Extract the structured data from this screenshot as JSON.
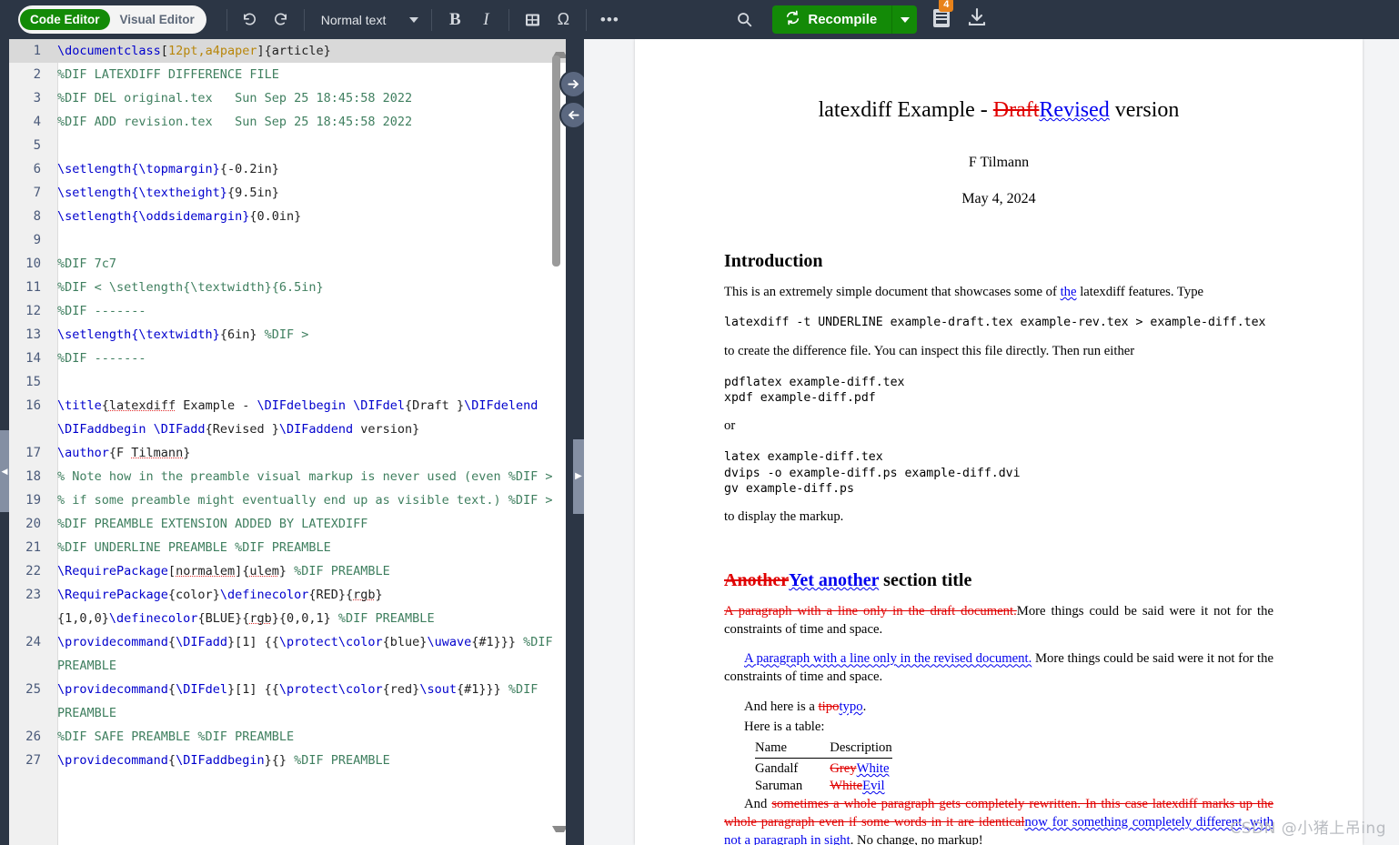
{
  "toolbar": {
    "code_editor_label": "Code Editor",
    "visual_editor_label": "Visual Editor",
    "undo_icon": "undo-icon",
    "redo_icon": "redo-icon",
    "style_select_value": "Normal text",
    "bold_label": "B",
    "italic_label": "I",
    "table_icon": "table-icon",
    "symbol_label": "Ω",
    "more_label": "•••",
    "search_icon": "search-icon",
    "recompile_label": "Recompile",
    "recompile_icon": "refresh-icon",
    "logs_icon": "logs-icon",
    "logs_badge": "4",
    "download_icon": "download-icon"
  },
  "splitter": {
    "sync_to_pdf_icon": "arrow-right-icon",
    "sync_to_code_icon": "arrow-left-icon",
    "handle_icon": "chevron-right-icon",
    "rail_handle_icon": "chevron-left-icon"
  },
  "editor": {
    "lines": [
      {
        "n": "1",
        "active": true,
        "tokens": [
          {
            "t": "\\documentclass",
            "c": "k-cmd"
          },
          {
            "t": "[",
            "c": "k-plain"
          },
          {
            "t": "12pt,a4paper",
            "c": "k-opt"
          },
          {
            "t": "]{article}",
            "c": "k-plain"
          }
        ]
      },
      {
        "n": "2",
        "tokens": [
          {
            "t": "%DIF LATEXDIFF DIFFERENCE FILE",
            "c": "k-com"
          }
        ]
      },
      {
        "n": "3",
        "tokens": [
          {
            "t": "%DIF DEL original.tex   Sun Sep 25 18:45:58 2022",
            "c": "k-com"
          }
        ]
      },
      {
        "n": "4",
        "tokens": [
          {
            "t": "%DIF ADD revision.tex   Sun Sep 25 18:45:58 2022",
            "c": "k-com"
          }
        ]
      },
      {
        "n": "5",
        "tokens": [
          {
            "t": "",
            "c": "k-plain"
          }
        ]
      },
      {
        "n": "6",
        "tokens": [
          {
            "t": "\\setlength{\\topmargin}",
            "c": "k-cmd"
          },
          {
            "t": "{-0.2in}",
            "c": "k-plain"
          }
        ]
      },
      {
        "n": "7",
        "tokens": [
          {
            "t": "\\setlength{\\textheight}",
            "c": "k-cmd"
          },
          {
            "t": "{9.5in}",
            "c": "k-plain"
          }
        ]
      },
      {
        "n": "8",
        "tokens": [
          {
            "t": "\\setlength{\\oddsidemargin}",
            "c": "k-cmd"
          },
          {
            "t": "{0.0in}",
            "c": "k-plain"
          }
        ]
      },
      {
        "n": "9",
        "tokens": [
          {
            "t": "",
            "c": "k-plain"
          }
        ]
      },
      {
        "n": "10",
        "tokens": [
          {
            "t": "%DIF 7c7",
            "c": "k-com"
          }
        ]
      },
      {
        "n": "11",
        "tokens": [
          {
            "t": "%DIF < \\setlength{\\textwidth}{6.5in}",
            "c": "k-com"
          }
        ]
      },
      {
        "n": "12",
        "tokens": [
          {
            "t": "%DIF -------",
            "c": "k-com"
          }
        ]
      },
      {
        "n": "13",
        "tokens": [
          {
            "t": "\\setlength{\\textwidth}",
            "c": "k-cmd"
          },
          {
            "t": "{6in} ",
            "c": "k-plain"
          },
          {
            "t": "%DIF >",
            "c": "k-com"
          }
        ]
      },
      {
        "n": "14",
        "tokens": [
          {
            "t": "%DIF -------",
            "c": "k-com"
          }
        ]
      },
      {
        "n": "15",
        "tokens": [
          {
            "t": "",
            "c": "k-plain"
          }
        ]
      },
      {
        "n": "16",
        "tokens": [
          {
            "t": "\\title",
            "c": "k-cmd"
          },
          {
            "t": "{",
            "c": "k-plain"
          },
          {
            "t": "latexdiff",
            "c": "k-plain sp"
          },
          {
            "t": " Example - ",
            "c": "k-plain"
          },
          {
            "t": "\\DIFdelbegin \\DIFdel",
            "c": "k-cmd"
          },
          {
            "t": "{Draft }",
            "c": "k-plain"
          },
          {
            "t": "\\DIFdelend \\DIFaddbegin \\DIFadd",
            "c": "k-cmd"
          },
          {
            "t": "{Revised }",
            "c": "k-plain"
          },
          {
            "t": "\\DIFaddend",
            "c": "k-cmd"
          },
          {
            "t": " version}",
            "c": "k-plain"
          }
        ]
      },
      {
        "n": "17",
        "tokens": [
          {
            "t": "\\author",
            "c": "k-cmd"
          },
          {
            "t": "{F ",
            "c": "k-plain"
          },
          {
            "t": "Tilmann",
            "c": "k-plain sp"
          },
          {
            "t": "}",
            "c": "k-plain"
          }
        ]
      },
      {
        "n": "18",
        "tokens": [
          {
            "t": "% Note how in the preamble visual markup is never used (even %DIF >",
            "c": "k-com"
          }
        ]
      },
      {
        "n": "19",
        "tokens": [
          {
            "t": "% if some preamble might eventually end up as visible text.) %DIF >",
            "c": "k-com"
          }
        ]
      },
      {
        "n": "20",
        "tokens": [
          {
            "t": "%DIF PREAMBLE EXTENSION ADDED BY LATEXDIFF",
            "c": "k-com"
          }
        ]
      },
      {
        "n": "21",
        "tokens": [
          {
            "t": "%DIF UNDERLINE PREAMBLE %DIF PREAMBLE",
            "c": "k-com"
          }
        ]
      },
      {
        "n": "22",
        "tokens": [
          {
            "t": "\\RequirePackage",
            "c": "k-cmd"
          },
          {
            "t": "[",
            "c": "k-plain"
          },
          {
            "t": "normalem",
            "c": "k-plain sp"
          },
          {
            "t": "]{",
            "c": "k-plain"
          },
          {
            "t": "ulem",
            "c": "k-plain sp"
          },
          {
            "t": "} ",
            "c": "k-plain"
          },
          {
            "t": "%DIF PREAMBLE",
            "c": "k-com"
          }
        ]
      },
      {
        "n": "23",
        "tokens": [
          {
            "t": "\\RequirePackage",
            "c": "k-cmd"
          },
          {
            "t": "{color}",
            "c": "k-plain"
          },
          {
            "t": "\\definecolor",
            "c": "k-cmd"
          },
          {
            "t": "{RED}{",
            "c": "k-plain"
          },
          {
            "t": "rgb",
            "c": "k-plain sp"
          },
          {
            "t": "}{1,0,0}",
            "c": "k-plain"
          },
          {
            "t": "\\definecolor",
            "c": "k-cmd"
          },
          {
            "t": "{BLUE}{",
            "c": "k-plain"
          },
          {
            "t": "rgb",
            "c": "k-plain sp"
          },
          {
            "t": "}{0,0,1} ",
            "c": "k-plain"
          },
          {
            "t": "%DIF PREAMBLE",
            "c": "k-com"
          }
        ]
      },
      {
        "n": "24",
        "tokens": [
          {
            "t": "\\providecommand",
            "c": "k-cmd"
          },
          {
            "t": "{",
            "c": "k-plain"
          },
          {
            "t": "\\DIFadd",
            "c": "k-cmd"
          },
          {
            "t": "}[1] {{",
            "c": "k-plain"
          },
          {
            "t": "\\protect\\color",
            "c": "k-cmd"
          },
          {
            "t": "{blue}",
            "c": "k-plain"
          },
          {
            "t": "\\uwave",
            "c": "k-cmd"
          },
          {
            "t": "{#1}}} ",
            "c": "k-plain"
          },
          {
            "t": "%DIF PREAMBLE",
            "c": "k-com"
          }
        ]
      },
      {
        "n": "25",
        "tokens": [
          {
            "t": "\\providecommand",
            "c": "k-cmd"
          },
          {
            "t": "{",
            "c": "k-plain"
          },
          {
            "t": "\\DIFdel",
            "c": "k-cmd"
          },
          {
            "t": "}[1] {{",
            "c": "k-plain"
          },
          {
            "t": "\\protect\\color",
            "c": "k-cmd"
          },
          {
            "t": "{red}",
            "c": "k-plain"
          },
          {
            "t": "\\sout",
            "c": "k-cmd"
          },
          {
            "t": "{#1}}} ",
            "c": "k-plain"
          },
          {
            "t": "%DIF PREAMBLE",
            "c": "k-com"
          }
        ]
      },
      {
        "n": "26",
        "tokens": [
          {
            "t": "%DIF SAFE PREAMBLE %DIF PREAMBLE",
            "c": "k-com"
          }
        ]
      },
      {
        "n": "27",
        "tokens": [
          {
            "t": "\\providecommand",
            "c": "k-cmd"
          },
          {
            "t": "{",
            "c": "k-plain"
          },
          {
            "t": "\\DIFaddbegin",
            "c": "k-cmd"
          },
          {
            "t": "}{} ",
            "c": "k-plain"
          },
          {
            "t": "%DIF PREAMBLE",
            "c": "k-com"
          }
        ]
      }
    ]
  },
  "pdf": {
    "title_prefix": "latexdiff Example - ",
    "title_del": "Draft",
    "title_add": "Revised",
    "title_suffix": " version",
    "author": "F Tilmann",
    "date": "May 4, 2024",
    "section1": "Introduction",
    "p1_a": "This is an extremely simple document that showcases some of ",
    "p1_add": "the",
    "p1_b": " latexdiff features. Type",
    "code1": "latexdiff -t UNDERLINE example-draft.tex example-rev.tex > example-diff.tex",
    "p2": "to create the difference file. You can inspect this file directly. Then run either",
    "code2": "pdflatex example-diff.tex\nxpdf example-diff.pdf",
    "p3": "or",
    "code3": "latex example-diff.tex\ndvips -o example-diff.ps example-diff.dvi\ngv example-diff.ps",
    "p4": "to display the markup.",
    "section2_del": "Another",
    "section2_add": "Yet another",
    "section2_rest": " section title",
    "p5_del": "A paragraph with a line only in the draft document.",
    "p5_rest": "More things could be said were it not for the constraints of time and space.",
    "p6_add": "A paragraph with a line only in the revised document.",
    "p6_rest": " More things could be said were it not for the constraints of time and space.",
    "p7_pre": "And here is a ",
    "p7_del": "tipo",
    "p7_add": "typo",
    "p7_post": ".",
    "p8": "Here is a table:",
    "table": {
      "headers": [
        "Name",
        "Description"
      ],
      "rows": [
        {
          "name": "Gandalf",
          "desc_del": "Grey",
          "desc_add": "White"
        },
        {
          "name": "Saruman",
          "desc_del": "White",
          "desc_add": "Evil"
        }
      ]
    },
    "p9_pre": "And ",
    "p9_del": "sometimes a whole paragraph gets completely rewritten. In this case latexdiff marks up the whole paragraph even if some words in it are identical",
    "p9_add": "now for something completely different, with not a paragraph in sight",
    "p9_post": ". No change, no markup!"
  },
  "watermark": "CSDN @小猪上吊ing"
}
